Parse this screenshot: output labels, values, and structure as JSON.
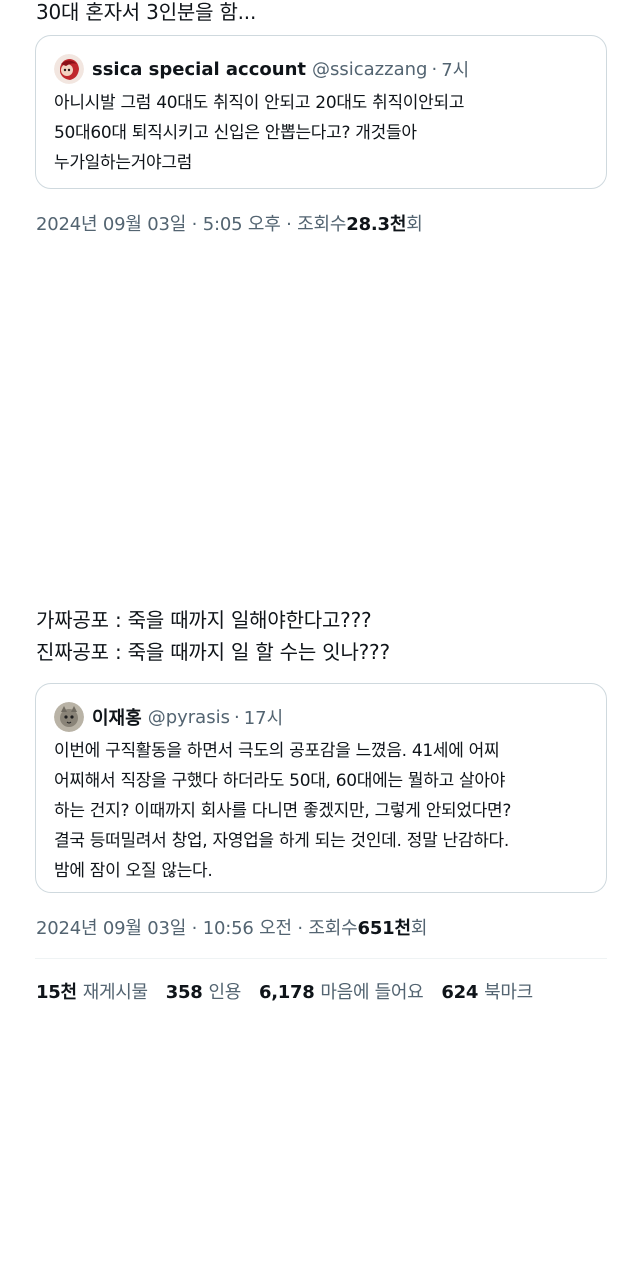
{
  "tweet1": {
    "text_line": "30대 혼자서 3인분을 함...",
    "quote": {
      "name": "ssica special account",
      "handle": "@ssicazzang",
      "separator": "·",
      "time": "7시",
      "lines": [
        "아니시발 그럼 40대도 취직이 안되고 20대도 취직이안되고",
        "50대60대 퇴직시키고 신입은 안뽑는다고? 개것들아",
        "누가일하는거야그럼"
      ]
    },
    "meta": {
      "date": "2024년 09월 03일",
      "sep1": "·",
      "time": "5:05 오후",
      "sep2": "·",
      "views_label": "조회수",
      "views_num": "28.3천",
      "views_suffix": "회"
    }
  },
  "tweet2": {
    "lines": [
      "가짜공포 : 죽을 때까지 일해야한다고???",
      "진짜공포 : 죽을 때까지 일 할 수는 잇나???"
    ],
    "quote": {
      "name": "이재홍",
      "handle": "@pyrasis",
      "separator": "·",
      "time": "17시",
      "lines": [
        "이번에 구직활동을 하면서 극도의 공포감을 느꼈음. 41세에 어찌",
        "어찌해서 직장을 구했다 하더라도 50대, 60대에는 뭘하고 살아야",
        "하는 건지? 이때까지 회사를 다니면 좋겠지만, 그렇게 안되었다면?",
        "결국 등떠밀려서 창업, 자영업을 하게 되는 것인데. 정말 난감하다.",
        "밤에 잠이 오질 않는다."
      ]
    },
    "meta": {
      "date": "2024년 09월 03일",
      "sep1": "·",
      "time": "10:56 오전",
      "sep2": "·",
      "views_label": "조회수",
      "views_num": "651천",
      "views_suffix": "회"
    },
    "stats": [
      {
        "num": "15천",
        "label": "재게시물"
      },
      {
        "num": "358",
        "label": "인용"
      },
      {
        "num": "6,178",
        "label": "마음에 들어요"
      },
      {
        "num": "624",
        "label": "북마크"
      }
    ]
  },
  "colors": {
    "text": "#0f1419",
    "secondary": "#536471",
    "border": "#cfd9de"
  }
}
